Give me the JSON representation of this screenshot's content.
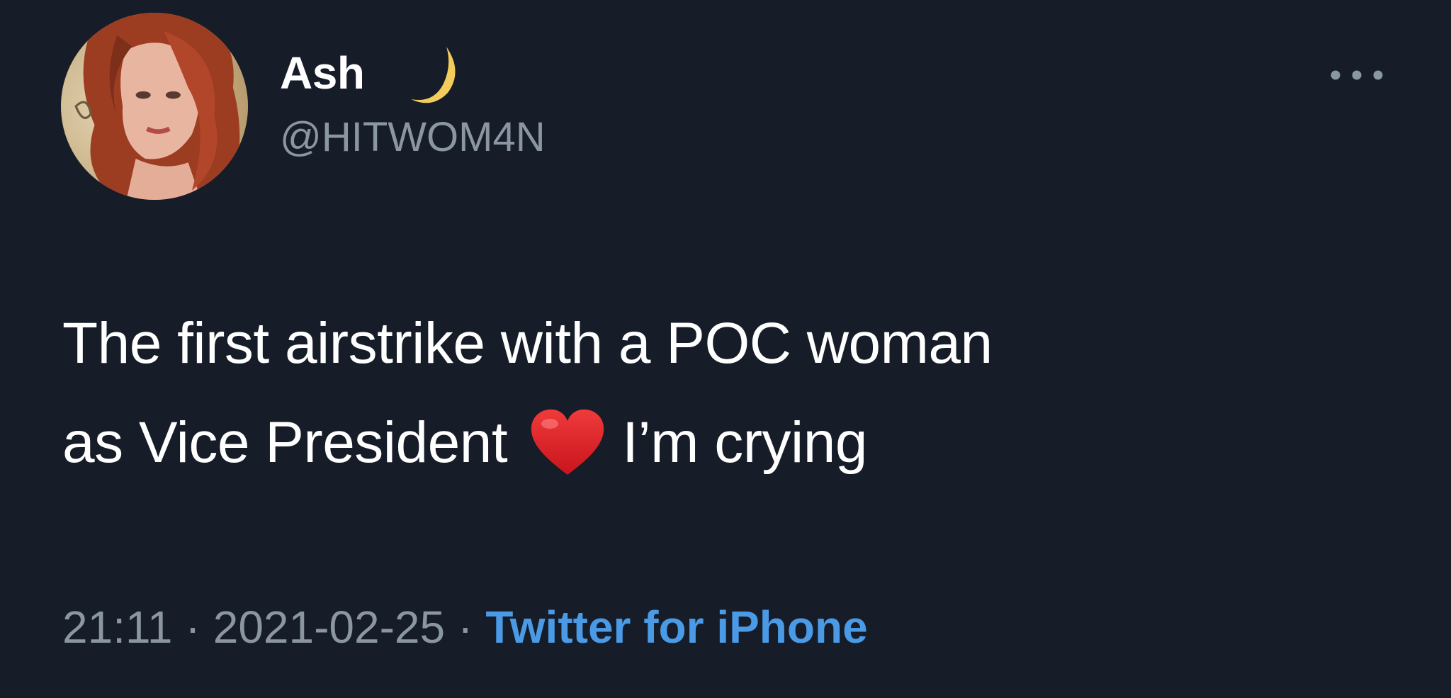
{
  "tweet": {
    "author": {
      "display_name": "Ash",
      "name_emoji": "crescent-moon-icon",
      "handle": "@HITWOM4N"
    },
    "text": {
      "line1": "The first airstrike with a POC woman",
      "line2_before": "as Vice President",
      "emoji": "red-heart-icon",
      "line2_after": "I’m crying"
    },
    "meta": {
      "time": "21:11",
      "separator": "·",
      "date": "2021-02-25",
      "source": "Twitter for iPhone"
    }
  },
  "colors": {
    "background": "#161c28",
    "text": "#ffffff",
    "secondary_text": "#8b96a3",
    "link": "#4a9ae6",
    "heart": "#e0242a",
    "moon": "#f3cd5b"
  }
}
